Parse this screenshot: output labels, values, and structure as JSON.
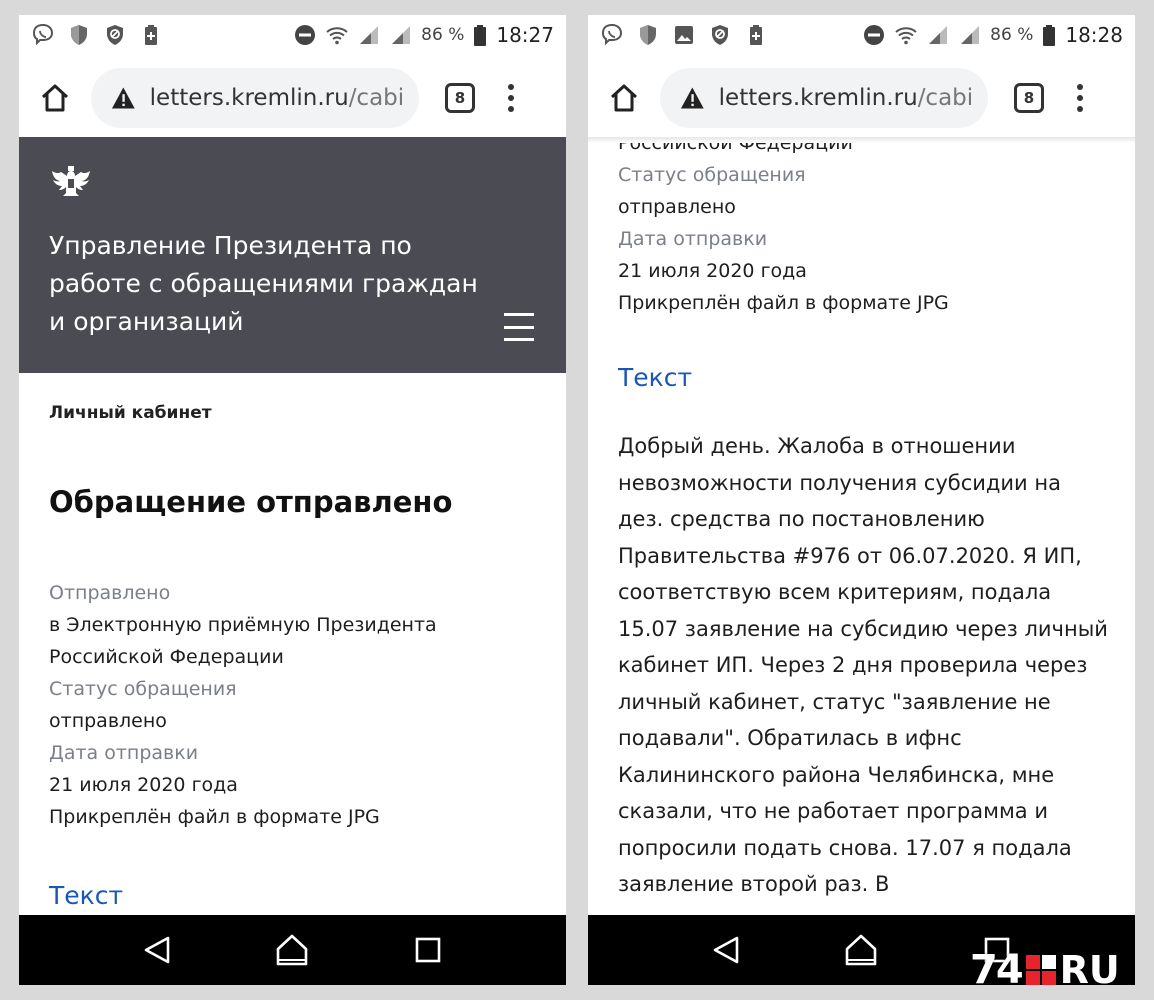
{
  "status_bar_left": {
    "battery_percent": "86 %",
    "time": "18:27"
  },
  "status_bar_right": {
    "battery_percent": "86 %",
    "time": "18:28"
  },
  "browser": {
    "url_domain": "letters.kremlin.ru",
    "url_path": "/cabin",
    "tab_count": "8"
  },
  "site_header": {
    "title": "Управление Президента по работе с обращениями граждан и организаций"
  },
  "page": {
    "breadcrumb": "Личный кабинет",
    "title": "Обращение отправлено",
    "sent_to_label": "Отправлено",
    "sent_to_value": "в Электронную приёмную Президента Российской Федерации",
    "sent_to_value_tail": "Российской Федерации",
    "status_label": "Статус обращения",
    "status_value": "отправлено",
    "date_label": "Дата отправки",
    "date_value": "21 июля 2020 года",
    "attachment": "Прикреплён файл в формате JPG",
    "text_heading": "Текст",
    "letter_text": "Добрый день. Жалоба в отношении невозможности получения субсидии на дез. средства по постановлению Правительства #976 от 06.07.2020. Я ИП, соответствую всем критериям, подала 15.07 заявление на субсидию через личный кабинет ИП. Через 2 дня проверила через личный кабинет, статус \"заявление не подавали\". Обратилась в ифнс Калининского района Челябинска, мне сказали, что не работает программа и попросили подать снова. 17.07 я подала заявление второй раз. В"
  },
  "watermark": {
    "number": "74",
    "suffix": "RU"
  },
  "colors": {
    "header_bg": "#4a4b53",
    "link_blue": "#1a57b5",
    "label_gray": "#7b7f87",
    "watermark_red": "#e5242c"
  },
  "icons": [
    "viber-icon",
    "shield-icon",
    "blocked-icon",
    "battery-plus-icon",
    "image-icon",
    "dnd-icon",
    "wifi-icon",
    "signal-icon",
    "battery-icon",
    "home-icon",
    "warning-icon",
    "tabs-icon",
    "more-vert-icon",
    "emblem-icon",
    "hamburger-icon",
    "back-icon",
    "nav-home-icon",
    "recents-icon"
  ]
}
